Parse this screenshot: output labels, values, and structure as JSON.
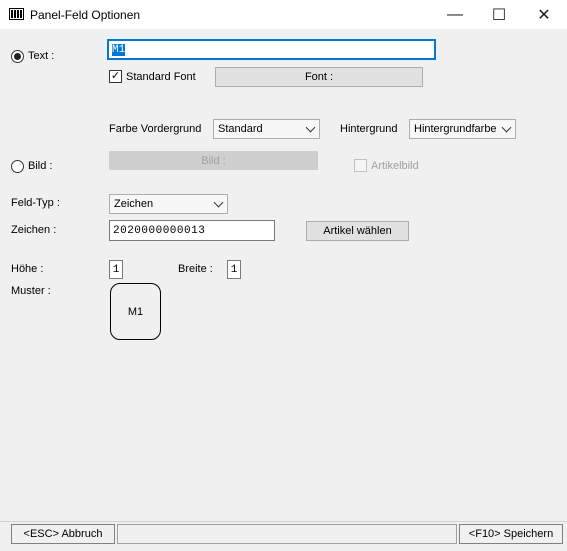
{
  "window": {
    "title": "Panel-Feld Optionen",
    "icon": "barcode-icon",
    "minimize": "—",
    "maximize": "☐",
    "close": "✕"
  },
  "text_option": {
    "label": "Text :",
    "selected": true,
    "value": "M1",
    "standard_font_label": "Standard Font",
    "standard_font_checked": true,
    "font_button": "Font :"
  },
  "colors": {
    "foreground_label": "Farbe Vordergrund",
    "foreground_value": "Standard",
    "background_label": "Hintergrund",
    "background_value": "Hintergrundfarbe"
  },
  "image_option": {
    "label": "Bild :",
    "selected": false,
    "image_button": "Bild :",
    "article_image_label": "Artikelbild"
  },
  "field": {
    "type_label": "Feld-Typ :",
    "type_value": "Zeichen",
    "chars_label": "Zeichen :",
    "chars_value": "2020000000013",
    "select_article_button": "Artikel wählen"
  },
  "size": {
    "height_label": "Höhe :",
    "height_value": "1",
    "width_label": "Breite :",
    "width_value": "1"
  },
  "pattern": {
    "label": "Muster :",
    "preview_text": "M1"
  },
  "footer": {
    "cancel": "<ESC> Abbruch",
    "save": "<F10> Speichern"
  },
  "accent_color": "#0078d7"
}
